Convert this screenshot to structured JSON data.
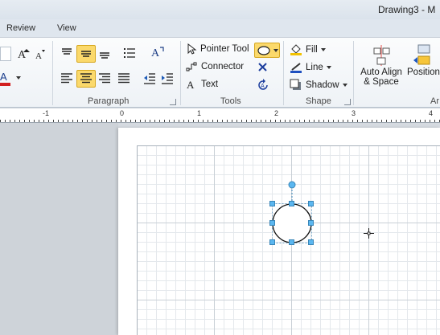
{
  "window": {
    "title": "Drawing3  -  M"
  },
  "tabs": [
    {
      "label": "Review"
    },
    {
      "label": "View"
    }
  ],
  "ribbon": {
    "groups": {
      "paragraph": "Paragraph",
      "tools": "Tools",
      "shape": "Shape"
    },
    "tools": {
      "pointer": "Pointer Tool",
      "connector": "Connector",
      "text": "Text"
    },
    "shape": {
      "fill": "Fill",
      "line": "Line",
      "shadow": "Shadow"
    },
    "arrange": {
      "auto_align_line1": "Auto Align",
      "auto_align_line2": "& Space",
      "position": "Position",
      "cut_label": "Ar"
    }
  },
  "ruler": {
    "labels": [
      "-1",
      "0",
      "1",
      "2",
      "3",
      "4"
    ]
  },
  "colors": {
    "font_color": "#d21f1f",
    "fill_color": "#f2c200",
    "line_color": "#1f4fbf",
    "selection": "#5bb7f0"
  },
  "icons": [
    "increase-font-icon",
    "decrease-font-icon",
    "font-color-icon",
    "align-top-icon",
    "align-middle-icon",
    "align-bottom-icon",
    "bullets-icon",
    "text-direction-icon",
    "align-left-icon",
    "align-center-icon",
    "align-right-icon",
    "justify-icon",
    "decrease-indent-icon",
    "increase-indent-icon",
    "pointer-icon",
    "connector-icon",
    "text-icon",
    "ellipse-icon",
    "connection-point-icon",
    "rotate-icon",
    "fill-icon",
    "line-icon",
    "shadow-icon",
    "auto-align-icon",
    "position-icon"
  ]
}
